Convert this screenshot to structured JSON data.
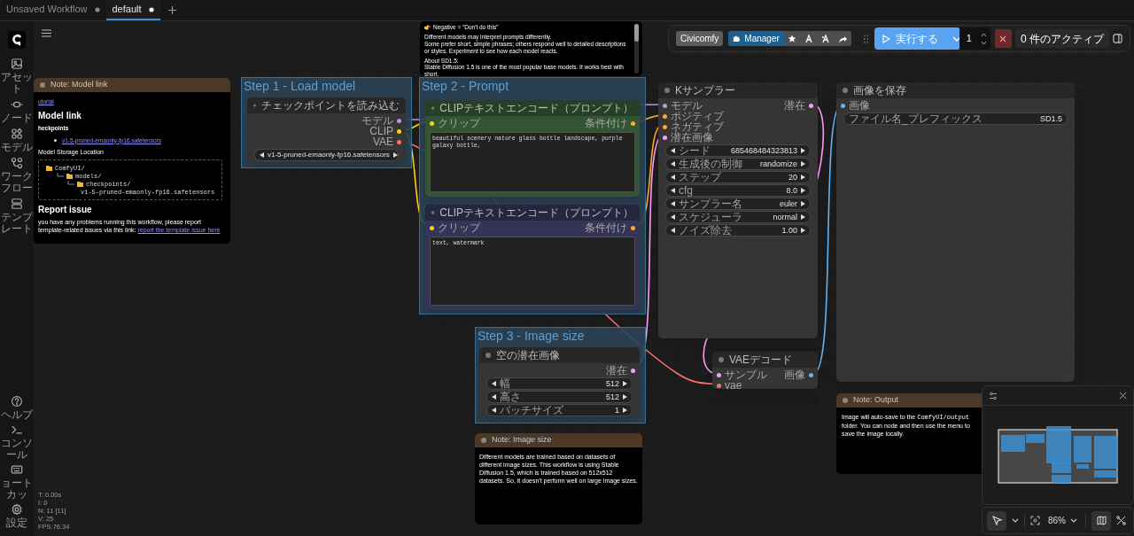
{
  "tabs": [
    {
      "label": "Unsaved Workflow",
      "selected": false
    },
    {
      "label": "default",
      "selected": true
    }
  ],
  "sidebar": {
    "top": [
      {
        "label": "アセット"
      },
      {
        "label": "ノード"
      },
      {
        "label": "モデル"
      },
      {
        "label": "ワークフロー"
      },
      {
        "label": "テンプレート"
      }
    ],
    "bottom": [
      {
        "label": "ヘルプ"
      },
      {
        "label": "コンソール"
      },
      {
        "label": "ョートカッ"
      },
      {
        "label": "設定"
      }
    ]
  },
  "toolbar": {
    "civicomfy": "Civicomfy",
    "manager": "Manager",
    "run": "実行する",
    "count": "1",
    "queue": "0 件のアクティブ"
  },
  "groups": [
    {
      "title": "Step 1 - Load model"
    },
    {
      "title": "Step 2 - Prompt"
    },
    {
      "title": "Step 3 - Image size"
    }
  ],
  "nodes": [
    {
      "title": "チェックポイントを読み込む",
      "outputs": [
        {
          "label": "モデル",
          "color": "#b39ddb"
        },
        {
          "label": "CLIP",
          "color": "#ffd500"
        },
        {
          "label": "VAE",
          "color": "#ff6e6e"
        }
      ],
      "widgets": [
        {
          "kind": "combo",
          "value": "v1-5-pruned-emaonly-fp16.safetensors"
        }
      ]
    },
    {
      "title": "CLIPテキストエンコード（プロンプト）",
      "color": "#335533",
      "inputs": [
        {
          "label": "クリップ",
          "color": "#ffd500"
        }
      ],
      "outputs": [
        {
          "label": "条件付け",
          "color": "#ffa931"
        }
      ],
      "text": "beautiful scenery nature glass bottle landscape, purple galaxy bottle,"
    },
    {
      "title": "CLIPテキストエンコード（プロンプト）",
      "color": "#353356",
      "inputs": [
        {
          "label": "クリップ",
          "color": "#ffd500"
        }
      ],
      "outputs": [
        {
          "label": "条件付け",
          "color": "#ffa931"
        }
      ],
      "text": "text, watermark"
    },
    {
      "title": "空の潜在画像",
      "outputs": [
        {
          "label": "潜在",
          "color": "#ff9cf9"
        }
      ],
      "widgets": [
        {
          "kind": "number",
          "label": "幅",
          "value": "512"
        },
        {
          "kind": "number",
          "label": "高さ",
          "value": "512"
        },
        {
          "kind": "number",
          "label": "バッチサイズ",
          "value": "1"
        }
      ]
    },
    {
      "title": "Kサンプラー",
      "inputs": [
        {
          "label": "モデル",
          "color": "#b39ddb"
        },
        {
          "label": "ポジティブ",
          "color": "#ffa931"
        },
        {
          "label": "ネガティブ",
          "color": "#ffa931"
        },
        {
          "label": "潜在画像",
          "color": "#ff9cf9"
        }
      ],
      "outputs": [
        {
          "label": "潜在",
          "color": "#ff9cf9"
        }
      ],
      "widgets": [
        {
          "kind": "number",
          "label": "シード",
          "value": "685468484323813"
        },
        {
          "kind": "combo",
          "label": "生成後の制御",
          "value": "randomize"
        },
        {
          "kind": "number",
          "label": "ステップ",
          "value": "20"
        },
        {
          "kind": "number",
          "label": "cfg",
          "value": "8.0"
        },
        {
          "kind": "combo",
          "label": "サンプラー名",
          "value": "euler"
        },
        {
          "kind": "combo",
          "label": "スケジューラ",
          "value": "normal"
        },
        {
          "kind": "number",
          "label": "ノイズ除去",
          "value": "1.00"
        }
      ]
    },
    {
      "title": "画像を保存",
      "inputs": [
        {
          "label": "画像",
          "color": "#64b5f6"
        }
      ],
      "widgets": [
        {
          "kind": "text",
          "label": "ファイル名_プレフィックス",
          "value": "SD1.5"
        }
      ]
    },
    {
      "title": "VAEデコード",
      "inputs": [
        {
          "label": "サンプル",
          "color": "#ff9cf9"
        },
        {
          "label": "vae",
          "color": "#ff6e6e"
        }
      ],
      "outputs": [
        {
          "label": "画像",
          "color": "#64b5f6"
        }
      ]
    }
  ],
  "notes": [
    {
      "blocks": [
        {
          "kind": "pointer",
          "text": "Negative = “Don't do this”"
        },
        {
          "kind": "paragraph",
          "text": "Different models may interpret prompts differently.\nSome prefer short, simple phrases; others respond well to detailed descriptions or styles. Experiment to see how each model reacts."
        },
        {
          "kind": "paragraph",
          "text": "About SD1.5:\nStable Diffusion 1.5 is one of the most popular base models. It works best with short,"
        }
      ]
    },
    {
      "title": "Note: Model link",
      "blocks": [
        {
          "kind": "link",
          "text": "utorial"
        },
        {
          "kind": "heading",
          "text": "Model link"
        },
        {
          "kind": "subheading",
          "text": "heckpoints"
        },
        {
          "kind": "bullet_link",
          "text": "v1-5-pruned-emaonly-fp16.safetensors"
        },
        {
          "kind": "paragraph",
          "text": "Model Storage Location"
        },
        {
          "kind": "tree",
          "root": {
            "name": "ComfyUI/",
            "children": [
              {
                "name": "models/",
                "children": [
                  {
                    "name": "checkpoints/",
                    "children": [
                      {
                        "name": "v1-5-pruned-emaonly-fp16.safetensors"
                      }
                    ]
                  }
                ]
              }
            ]
          }
        },
        {
          "kind": "heading",
          "text": "Report issue"
        },
        {
          "kind": "paragraph",
          "text": "you have any problems running this workflow, please report template-related issues via this link: ",
          "link": "report the template issue here"
        }
      ]
    },
    {
      "title": "Note: Image size",
      "blocks": [
        {
          "kind": "paragraph",
          "text": "Different models are trained based on datasets of different image sizes. This workflow is using Stable Diffusion 1.5, which is trained based on 512x512 datasets. So, it doesn't perform well on large image sizes."
        }
      ]
    },
    {
      "title": "Note: Output",
      "blocks": [
        {
          "kind": "code_paragraph",
          "before": "Image will auto-save to the ",
          "code": "ComfyUI/output",
          "after": " folder. You can node and then use the menu to save the image locally."
        }
      ]
    }
  ],
  "stats": [
    "T: 0.00s",
    "I: 0",
    "N: 11 [11]",
    "V: 25",
    "FPS:76.34"
  ],
  "zoom": "86%"
}
